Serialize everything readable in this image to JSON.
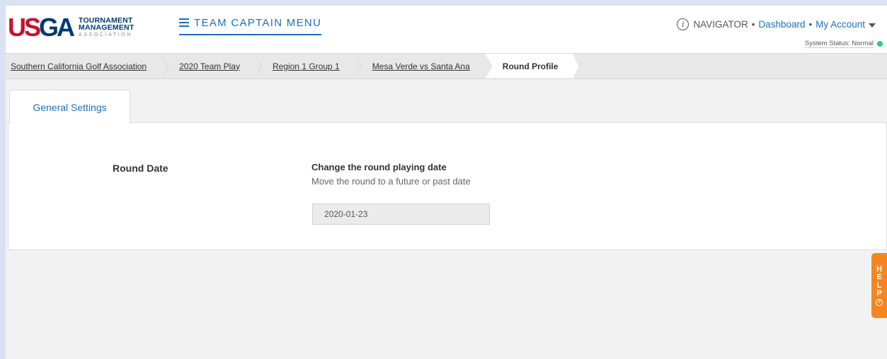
{
  "logo": {
    "usga_left": "US",
    "usga_right": "GA",
    "line1": "TOURNAMENT",
    "line2": "MANAGEMENT",
    "line3": "ASSOCIATION",
    "alt": "USGA Tournament Management"
  },
  "menu": {
    "label": "TEAM CAPTAIN MENU",
    "icon": "hamburger-icon"
  },
  "topnav": {
    "navigator_icon": "navigator-compass-icon",
    "navigator": "NAVIGATOR",
    "sep": "•",
    "dashboard": "Dashboard",
    "account": "My Account",
    "status_text": "System Status: Normal",
    "status_color": "#2ecc71"
  },
  "breadcrumb": [
    {
      "label": "Southern California Golf Association"
    },
    {
      "label": "2020 Team Play"
    },
    {
      "label": "Region 1 Group 1"
    },
    {
      "label": "Mesa Verde vs Santa Ana"
    },
    {
      "label": "Round Profile"
    }
  ],
  "tabs": [
    {
      "label": "General Settings",
      "active": true
    }
  ],
  "settings": {
    "round_date_label": "Round Date",
    "title": "Change the round playing date",
    "description": "Move the round to a future or past date",
    "date_value": "2020-01-23"
  },
  "help": {
    "letters": [
      "H",
      "E",
      "L",
      "P"
    ],
    "icon": "question-circle-icon",
    "q": "?"
  },
  "colors": {
    "accent": "#1a6fc2",
    "brand_red": "#c8102e",
    "brand_navy": "#003c71",
    "help": "#f5861f"
  }
}
